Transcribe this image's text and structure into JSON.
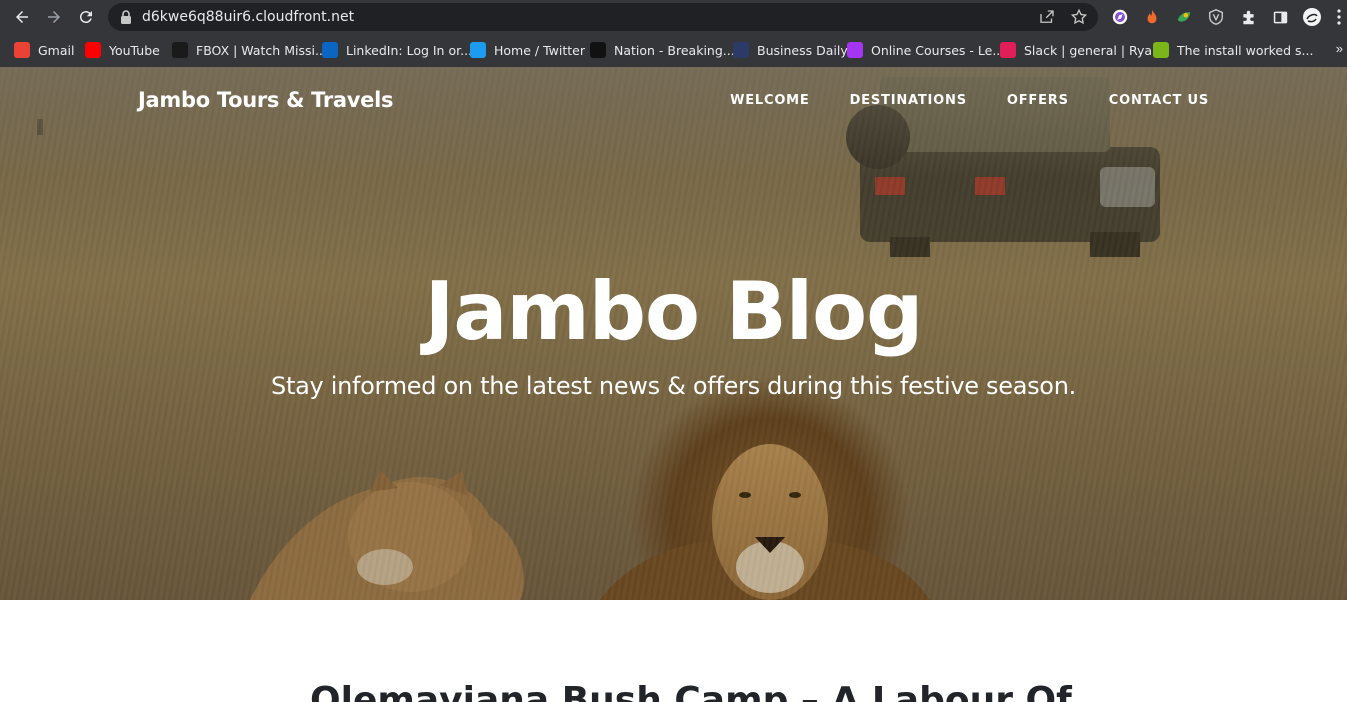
{
  "browser": {
    "url": "d6kwe6q88uir6.cloudfront.net",
    "bookmarks": [
      {
        "label": "Gmail",
        "icon": "gmail-icon",
        "color": "#ea4335"
      },
      {
        "label": "YouTube",
        "icon": "youtube-icon",
        "color": "#ff0000"
      },
      {
        "label": "FBOX | Watch Missi...",
        "icon": "fbox-icon",
        "color": "#1a1a1a"
      },
      {
        "label": "LinkedIn: Log In or...",
        "icon": "linkedin-icon",
        "color": "#0a66c2"
      },
      {
        "label": "Home / Twitter",
        "icon": "twitter-icon",
        "color": "#1d9bf0"
      },
      {
        "label": "Nation - Breaking...",
        "icon": "nation-icon",
        "color": "#111111"
      },
      {
        "label": "Business Daily",
        "icon": "business-daily-icon",
        "color": "#2b3a67"
      },
      {
        "label": "Online Courses - Le...",
        "icon": "udemy-icon",
        "color": "#a435f0"
      },
      {
        "label": "Slack | general | Rya...",
        "icon": "slack-icon",
        "color": "#e01e5a"
      },
      {
        "label": "The install worked s...",
        "icon": "django-icon",
        "color": "#7cb518"
      }
    ],
    "more": "»"
  },
  "site": {
    "brand": "Jambo Tours & Travels",
    "nav": [
      "WELCOME",
      "DESTINATIONS",
      "OFFERS",
      "CONTACT US"
    ]
  },
  "hero": {
    "title": "Jambo Blog",
    "subtitle": "Stay informed on the latest news & offers during this festive season."
  },
  "post": {
    "title": "Olemaviana Bush Camp – A Labour Of"
  }
}
